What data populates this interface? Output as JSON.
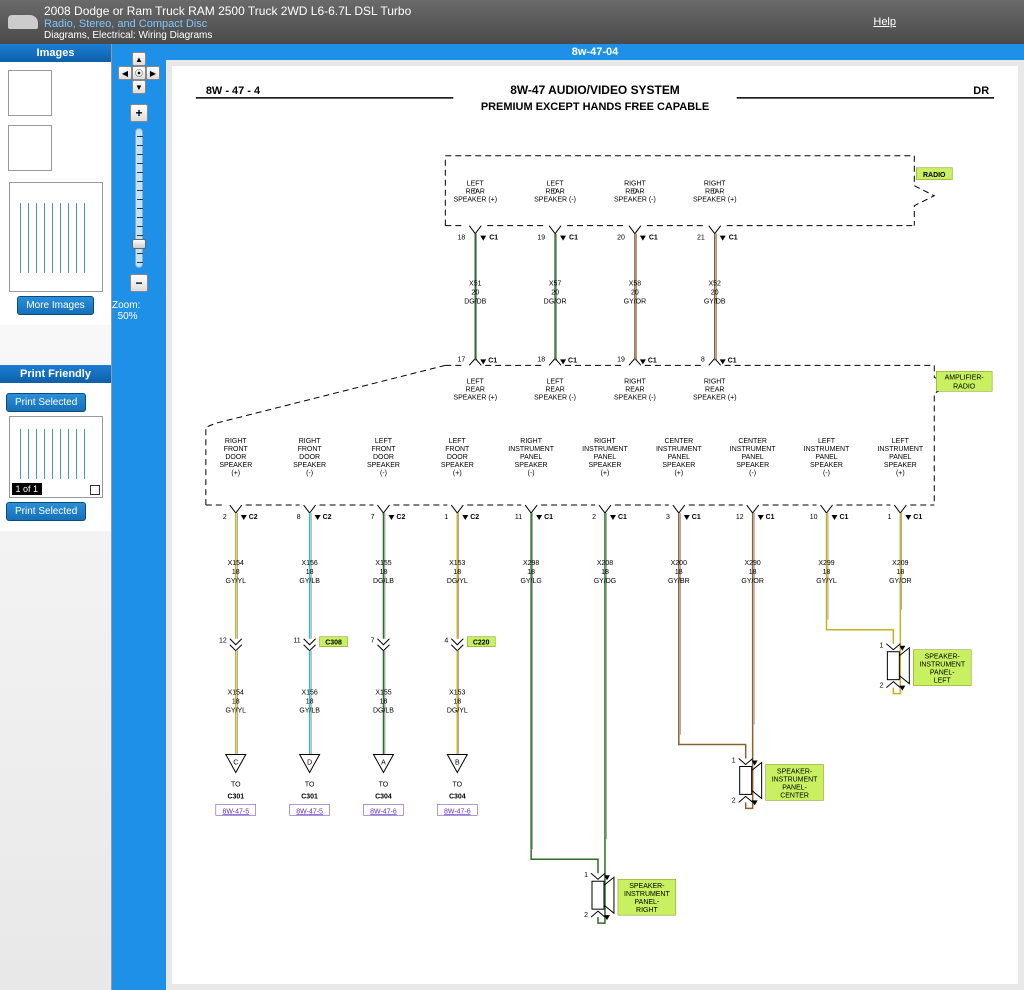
{
  "header": {
    "title": "2008 Dodge or Ram Truck RAM 2500 Truck 2WD L6-6.7L DSL Turbo",
    "subtitle": "Radio, Stereo, and Compact Disc",
    "breadcrumb": "Diagrams, Electrical: Wiring Diagrams",
    "help": "Help"
  },
  "sidebar": {
    "images_header": "Images",
    "more_images": "More Images",
    "print_header": "Print Friendly",
    "print_selected": "Print Selected",
    "page_of": "1 of 1"
  },
  "zoom": {
    "label": "Zoom:",
    "value": "50%"
  },
  "diagram": {
    "tab_title": "8w-47-04",
    "page_code": "8W - 47 - 4",
    "title": "8W-47 AUDIO/VIDEO SYSTEM",
    "subtitle": "PREMIUM EXCEPT HANDS FREE CAPABLE",
    "dr": "DR",
    "radio_label": "RADIO",
    "amp_label": "AMPLIFIER- RADIO",
    "radio_pins": [
      {
        "label": "LEFT REAR SPEAKER (+)",
        "pin": "18",
        "conn": "C1",
        "circuit": "X51",
        "gauge": "20",
        "color": "DG/DB",
        "wire": "#2a6e2a"
      },
      {
        "label": "LEFT REAR SPEAKER (-)",
        "pin": "19",
        "conn": "C1",
        "circuit": "X57",
        "gauge": "20",
        "color": "DG/OR",
        "wire": "#2a6e2a"
      },
      {
        "label": "RIGHT REAR SPEAKER (-)",
        "pin": "20",
        "conn": "C1",
        "circuit": "X58",
        "gauge": "20",
        "color": "GY/OR",
        "wire": "#8a6030"
      },
      {
        "label": "RIGHT REAR SPEAKER (+)",
        "pin": "21",
        "conn": "C1",
        "circuit": "X52",
        "gauge": "20",
        "color": "GY/DB",
        "wire": "#8a6030"
      }
    ],
    "amp_top_pins": [
      {
        "label": "LEFT REAR SPEAKER (+)",
        "pin": "17",
        "conn": "C1"
      },
      {
        "label": "LEFT REAR SPEAKER (-)",
        "pin": "18",
        "conn": "C1"
      },
      {
        "label": "RIGHT REAR SPEAKER (-)",
        "pin": "19",
        "conn": "C1"
      },
      {
        "label": "RIGHT REAR SPEAKER (+)",
        "pin": "8",
        "conn": "C1"
      }
    ],
    "amp_pins": [
      {
        "label": "RIGHT FRONT DOOR SPEAKER (+)",
        "pin": "2",
        "conn": "C2",
        "circuit": "X154",
        "gauge": "18",
        "color": "GY/YL",
        "wire": "#c8b020",
        "dest": "C301",
        "inline_pin": "12",
        "inline": "C308",
        "ref": "8W-47-5",
        "tri": "C"
      },
      {
        "label": "RIGHT FRONT DOOR SPEAKER (-)",
        "pin": "8",
        "conn": "C2",
        "circuit": "X156",
        "gauge": "18",
        "color": "GY/LB",
        "wire": "#30c0c8",
        "dest": "C301",
        "inline_pin": "11",
        "inline": "C308",
        "ref": "8W-47-5",
        "tri": "D"
      },
      {
        "label": "LEFT FRONT DOOR SPEAKER (-)",
        "pin": "7",
        "conn": "C2",
        "circuit": "X155",
        "gauge": "18",
        "color": "DG/LB",
        "wire": "#2a6e2a",
        "dest": "C304",
        "inline_pin": "7",
        "inline": "C220",
        "ref": "8W-47-6",
        "tri": "A"
      },
      {
        "label": "LEFT FRONT DOOR SPEAKER (+)",
        "pin": "1",
        "conn": "C2",
        "circuit": "X153",
        "gauge": "18",
        "color": "DG/YL",
        "wire": "#c8b020",
        "dest": "C304",
        "inline_pin": "4",
        "inline": "C220",
        "ref": "8W-47-6",
        "tri": "B"
      },
      {
        "label": "RIGHT INSTRUMENT PANEL SPEAKER (-)",
        "pin": "11",
        "conn": "C1",
        "circuit": "X298",
        "gauge": "18",
        "color": "GY/LG",
        "wire": "#2a6e2a",
        "spk": "SPEAKER- INSTRUMENT PANEL- RIGHT"
      },
      {
        "label": "RIGHT INSTRUMENT PANEL SPEAKER (+)",
        "pin": "2",
        "conn": "C1",
        "circuit": "X208",
        "gauge": "18",
        "color": "GY/DG",
        "wire": "#2a6e2a"
      },
      {
        "label": "CENTER INSTRUMENT PANEL SPEAKER (+)",
        "pin": "3",
        "conn": "C1",
        "circuit": "X200",
        "gauge": "18",
        "color": "GY/BR",
        "wire": "#8a6030",
        "spk": "SPEAKER- INSTRUMENT PANEL- CENTER"
      },
      {
        "label": "CENTER INSTRUMENT PANEL SPEAKER (-)",
        "pin": "12",
        "conn": "C1",
        "circuit": "X290",
        "gauge": "18",
        "color": "GY/OR",
        "wire": "#8a6030"
      },
      {
        "label": "LEFT INSTRUMENT PANEL SPEAKER (-)",
        "pin": "10",
        "conn": "C1",
        "circuit": "X299",
        "gauge": "18",
        "color": "GY/YL",
        "wire": "#c8b020",
        "spk": "SPEAKER- INSTRUMENT PANEL- LEFT"
      },
      {
        "label": "LEFT INSTRUMENT PANEL SPEAKER (+)",
        "pin": "1",
        "conn": "C1",
        "circuit": "X209",
        "gauge": "18",
        "color": "GY/OR",
        "wire": "#c8b020"
      }
    ],
    "to_label": "TO"
  }
}
